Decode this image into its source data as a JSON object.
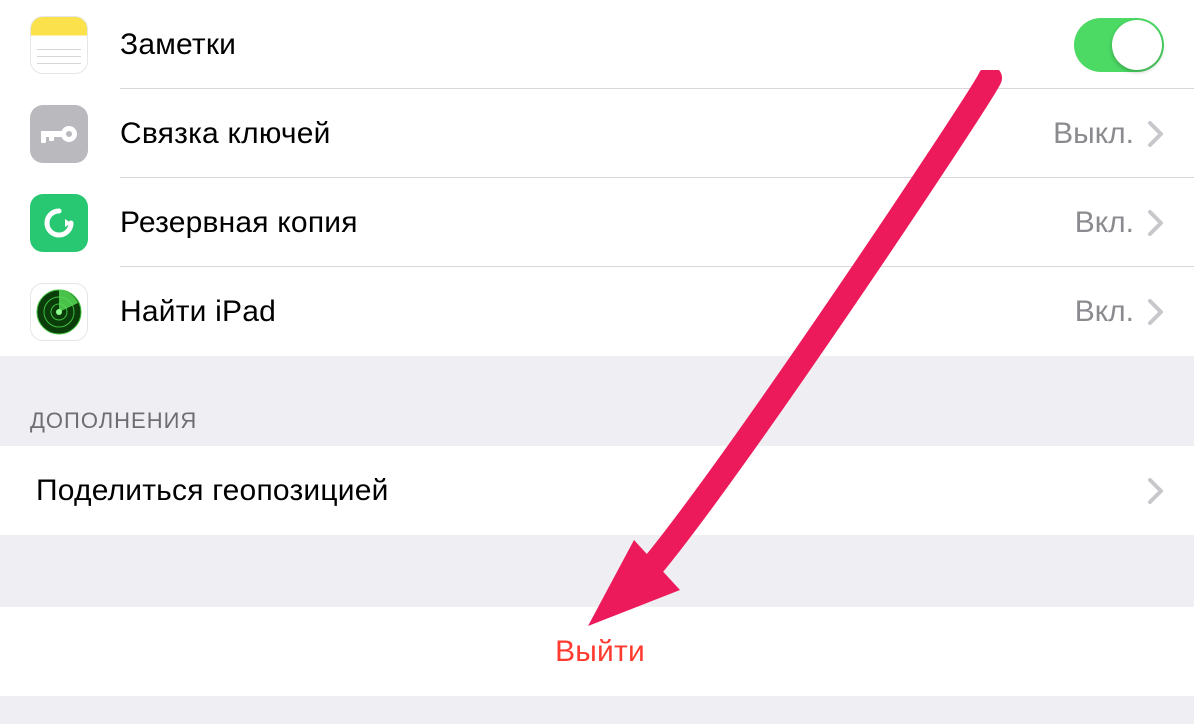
{
  "icloud": {
    "items": [
      {
        "label": "Заметки",
        "toggle": true
      },
      {
        "label": "Связка ключей",
        "value": "Выкл."
      },
      {
        "label": "Резервная копия",
        "value": "Вкл."
      },
      {
        "label": "Найти iPad",
        "value": "Вкл."
      }
    ]
  },
  "additions": {
    "header": "ДОПОЛНЕНИЯ",
    "items": [
      {
        "label": "Поделиться геопозицией"
      }
    ]
  },
  "signout": {
    "label": "Выйти"
  },
  "colors": {
    "accent_green": "#4cd964",
    "destructive": "#ff3b30",
    "arrow": "#ed1a5b"
  }
}
